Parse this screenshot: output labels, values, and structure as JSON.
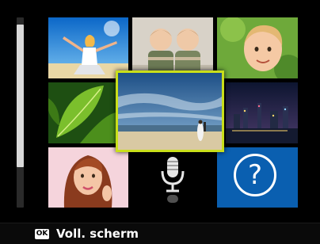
{
  "thumbnail_grid": {
    "scroll_position": 0.15,
    "scroll_visible_fraction": 0.75,
    "tiles": [
      {
        "id": "photo-1",
        "content": "photo"
      },
      {
        "id": "photo-2",
        "content": "photo"
      },
      {
        "id": "photo-3",
        "content": "photo"
      },
      {
        "id": "photo-4",
        "content": "photo"
      },
      {
        "id": "photo-5",
        "content": "photo",
        "selected": true
      },
      {
        "id": "photo-6",
        "content": "photo"
      },
      {
        "id": "photo-7",
        "content": "photo"
      },
      {
        "id": "voice-memo",
        "content": "microphone-icon"
      },
      {
        "id": "help",
        "content": "question-mark-icon"
      }
    ],
    "selection_color": "#c9df1a",
    "help_tile_color": "#0a5fb0"
  },
  "footer": {
    "ok_badge": "OK",
    "ok_label": "Voll. scherm"
  },
  "help_symbol": "?"
}
